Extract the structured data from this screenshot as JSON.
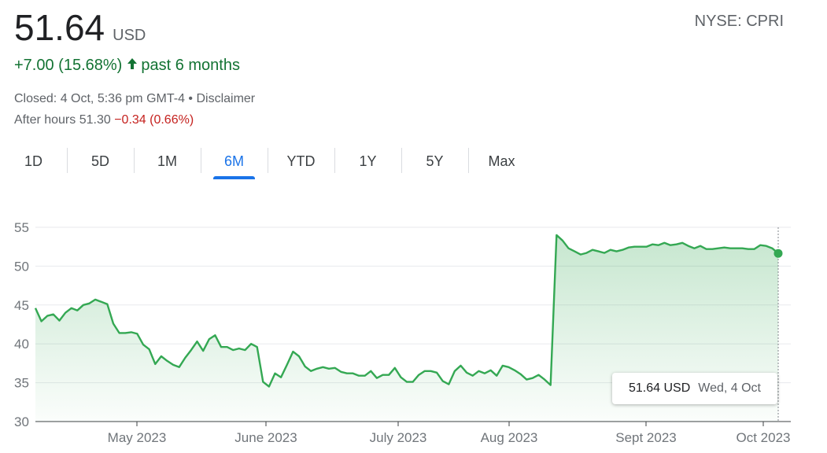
{
  "header": {
    "price": "51.64",
    "currency": "USD",
    "ticker": "NYSE: CPRI",
    "change": "+7.00 (15.68%)",
    "change_period": "past 6 months",
    "closed_text": "Closed: 4 Oct, 5:36 pm GMT-4 • Disclaimer",
    "after_hours_label": "After hours 51.30",
    "after_hours_change": "−0.34 (0.66%)"
  },
  "tabs": [
    {
      "label": "1D"
    },
    {
      "label": "5D"
    },
    {
      "label": "1M"
    },
    {
      "label": "6M"
    },
    {
      "label": "YTD"
    },
    {
      "label": "1Y"
    },
    {
      "label": "5Y"
    },
    {
      "label": "Max"
    }
  ],
  "active_tab": "6M",
  "colors": {
    "line": "#34a853",
    "positive": "#137333",
    "negative": "#c5221f",
    "accent": "#1a73e8"
  },
  "tooltip": {
    "value": "51.64 USD",
    "date": "Wed, 4 Oct"
  },
  "chart_data": {
    "type": "area",
    "x_labels": [
      "May 2023",
      "June 2023",
      "July 2023",
      "Aug 2023",
      "Sept 2023",
      "Oct 2023"
    ],
    "y_ticks": [
      30,
      35,
      40,
      45,
      50,
      55
    ],
    "ylim": [
      30,
      55
    ],
    "grid": true,
    "series": [
      {
        "values": [
          44.6,
          42.9,
          43.6,
          43.8,
          43.0,
          44.0,
          44.6,
          44.3,
          45.0,
          45.2,
          45.7,
          45.4,
          45.1,
          42.6,
          41.4,
          41.4,
          41.5,
          41.3,
          39.9,
          39.3,
          37.4,
          38.4,
          37.8,
          37.3,
          37.0,
          38.2,
          39.2,
          40.3,
          39.1,
          40.6,
          41.1,
          39.6,
          39.6,
          39.2,
          39.4,
          39.2,
          40.0,
          39.6,
          35.1,
          34.5,
          36.2,
          35.7,
          37.3,
          39.0,
          38.4,
          37.1,
          36.5,
          36.8,
          37.0,
          36.8,
          36.9,
          36.4,
          36.2,
          36.2,
          35.9,
          35.9,
          36.5,
          35.6,
          36.0,
          36.0,
          36.9,
          35.7,
          35.1,
          35.1,
          36.0,
          36.5,
          36.5,
          36.3,
          35.2,
          34.8,
          36.5,
          37.2,
          36.3,
          35.9,
          36.5,
          36.2,
          36.6,
          35.9,
          37.2,
          37.0,
          36.6,
          36.1,
          35.4,
          35.6,
          36.0,
          35.4,
          34.7,
          54.0,
          53.3,
          52.3,
          51.9,
          51.5,
          51.7,
          52.1,
          51.9,
          51.7,
          52.1,
          51.9,
          52.1,
          52.4,
          52.5,
          52.5,
          52.5,
          52.8,
          52.7,
          53.0,
          52.7,
          52.8,
          53.0,
          52.6,
          52.3,
          52.6,
          52.2,
          52.2,
          52.3,
          52.4,
          52.3,
          52.3,
          52.3,
          52.2,
          52.2,
          52.7,
          52.6,
          52.3,
          51.64
        ]
      }
    ]
  }
}
